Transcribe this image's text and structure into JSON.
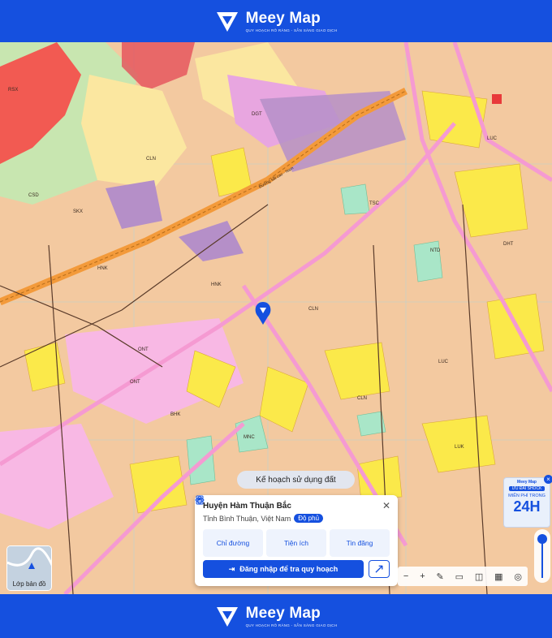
{
  "header": {
    "brand": "Meey Map",
    "tagline": "QUY HOẠCH RÕ RÀNG - SẴN SÀNG GIAO DỊCH"
  },
  "footer": {
    "brand": "Meey Map",
    "tagline": "QUY HOẠCH RÕ RÀNG - SẴN SÀNG GIAO DỊCH"
  },
  "map": {
    "plan_label": "Kế hoạch sử dụng đất",
    "layer_button": "Lớp bản đồ",
    "road_label": "Đường sắt cao - Nam",
    "zone_labels": [
      "CLN",
      "HNK",
      "LUC",
      "ONT",
      "NTD",
      "MNC",
      "BHK",
      "DGT",
      "SKX",
      "TSC",
      "CSD",
      "RSX",
      "DHT",
      "LUK",
      "HNK",
      "CLN",
      "CLN",
      "ONT",
      "LUC"
    ]
  },
  "info_panel": {
    "title": "Huyện Hàm Thuận Bắc",
    "subtitle": "Tỉnh Bình Thuận, Việt Nam",
    "badge": "Độ phủ",
    "actions": [
      {
        "label": "Chỉ đường",
        "icon": "directions-icon"
      },
      {
        "label": "Tiện ích",
        "icon": "amenities-icon"
      },
      {
        "label": "Tin đăng",
        "icon": "listings-icon"
      }
    ],
    "login_button": "Đăng nhập để tra quy hoạch"
  },
  "ad": {
    "brand": "Meey Map",
    "pill": "ƯU ĐÃI SHOCK",
    "small": "MIỄN PHÍ TRONG",
    "big": "24H"
  },
  "colors": {
    "brand": "#1550df",
    "residential": "#f3c9a0",
    "perennial": "#fbe9a0",
    "road": "#f39a3a",
    "pink": "#f59ad2"
  }
}
